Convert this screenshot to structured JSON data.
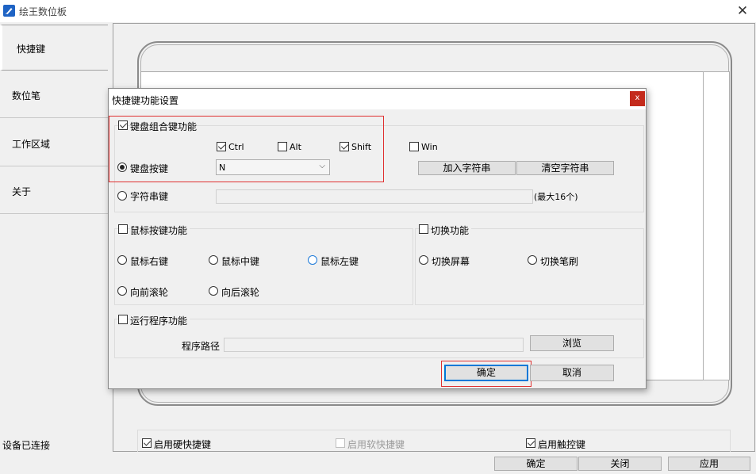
{
  "window": {
    "title": "绘王数位板"
  },
  "sidebar": {
    "items": [
      {
        "label": "快捷键"
      },
      {
        "label": "数位笔"
      },
      {
        "label": "工作区域"
      },
      {
        "label": "关于"
      }
    ],
    "status": "设备已连接"
  },
  "bottom_checks": {
    "hard_shortcut": {
      "label": "启用硬快捷键",
      "checked": true
    },
    "soft_shortcut": {
      "label": "启用软快捷键",
      "checked": false,
      "disabled": true
    },
    "touch": {
      "label": "启用触控键",
      "checked": true
    }
  },
  "footer_buttons": {
    "ok": "确定",
    "close": "关闭",
    "apply": "应用"
  },
  "dialog": {
    "title": "快捷键功能设置",
    "close_label": "x",
    "keyboard_combo": {
      "label": "键盘组合键功能",
      "checked": true
    },
    "modifiers": {
      "ctrl": {
        "label": "Ctrl",
        "checked": true
      },
      "alt": {
        "label": "Alt",
        "checked": false
      },
      "shift": {
        "label": "Shift",
        "checked": true
      },
      "win": {
        "label": "Win",
        "checked": false
      }
    },
    "key_radio": {
      "label": "键盘按键",
      "selected": true
    },
    "key_select": {
      "value": "N"
    },
    "add_string_button": "加入字符串",
    "clear_string_button": "清空字符串",
    "string_radio": {
      "label": "字符串键",
      "selected": false
    },
    "string_value": "",
    "string_limit": "(最大16个)",
    "mouse": {
      "label": "鼠标按键功能",
      "checked": false,
      "options": [
        {
          "label": "鼠标右键",
          "selected": false
        },
        {
          "label": "鼠标中键",
          "selected": false
        },
        {
          "label": "鼠标左键",
          "selected": false
        },
        {
          "label": "向前滚轮",
          "selected": false
        },
        {
          "label": "向后滚轮",
          "selected": false
        }
      ]
    },
    "switch": {
      "label": "切换功能",
      "checked": false,
      "options": [
        {
          "label": "切换屏幕",
          "selected": false
        },
        {
          "label": "切换笔刷",
          "selected": false
        }
      ]
    },
    "run_program": {
      "label": "运行程序功能",
      "checked": false
    },
    "program_path_label": "程序路径",
    "program_path_value": "",
    "browse_button": "浏览",
    "ok_button": "确定",
    "cancel_button": "取消"
  },
  "colors": {
    "accent": "#0078d7",
    "highlight_border": "#e03030",
    "close_red": "#c42b1c"
  }
}
